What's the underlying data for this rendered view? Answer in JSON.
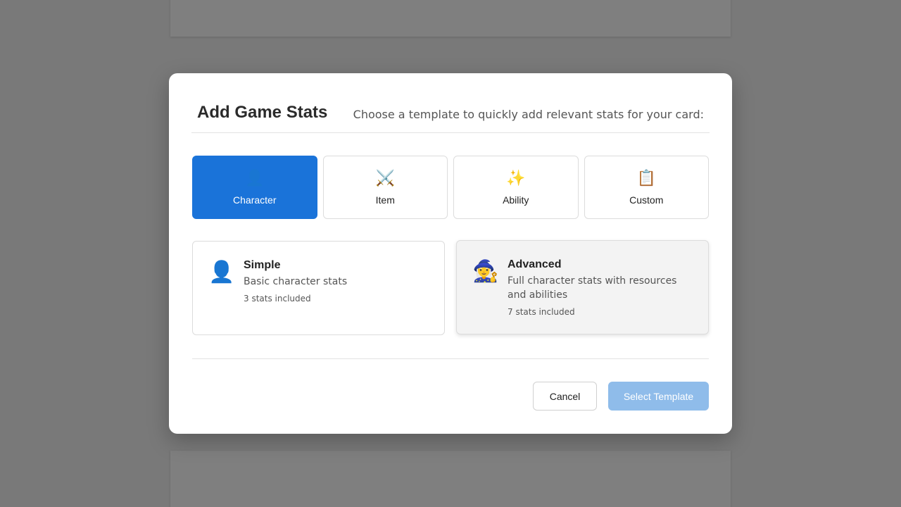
{
  "modal": {
    "title": "Add Game Stats",
    "subtitle": "Choose a template to quickly add relevant stats for your card:"
  },
  "type_tabs": [
    {
      "label": "Character",
      "icon": "👤",
      "icon_name": "person-silhouette-icon",
      "active": true
    },
    {
      "label": "Item",
      "icon": "⚔️",
      "icon_name": "crossed-swords-icon",
      "active": false
    },
    {
      "label": "Ability",
      "icon": "✨",
      "icon_name": "sparkles-icon",
      "active": false
    },
    {
      "label": "Custom",
      "icon": "📋",
      "icon_name": "clipboard-icon",
      "active": false
    }
  ],
  "templates": [
    {
      "name": "Simple",
      "description": "Basic character stats",
      "count": "3 stats included",
      "icon": "👤",
      "icon_name": "person-silhouette-icon"
    },
    {
      "name": "Advanced",
      "description": "Full character stats with resources and abilities",
      "count": "7 stats included",
      "icon": "🧙‍♀️",
      "icon_name": "mage-icon"
    }
  ],
  "buttons": {
    "cancel": "Cancel",
    "select": "Select Template"
  },
  "colors": {
    "accent": "#1a73d9",
    "select_disabled": "#8fbcea",
    "overlay": "rgba(0,0,0,0.5)"
  }
}
